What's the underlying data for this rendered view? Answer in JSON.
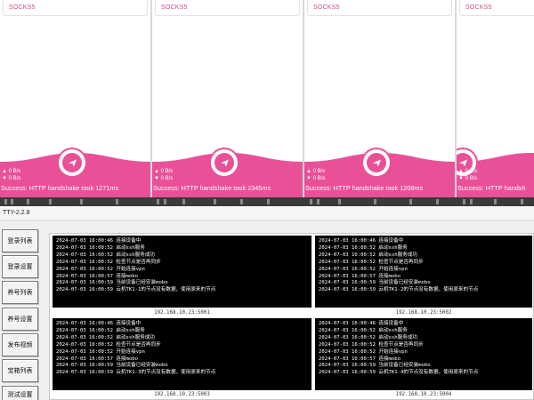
{
  "phones": [
    {
      "protocol": "SOCKS5",
      "up": "▲  0 B/s",
      "down": "▼  0 B/s",
      "status": "Success: HTTP handshake took 1271ms"
    },
    {
      "protocol": "SOCKS5",
      "up": "▲  0 B/s",
      "down": "▼  0 B/s",
      "status": "Success: HTTP handshake took 2345ms"
    },
    {
      "protocol": "SOCKS5",
      "up": "▲  0 B/s",
      "down": "▼  0 B/s",
      "status": "Success: HTTP handshake took 1208ms"
    },
    {
      "protocol": "SOCKS5",
      "up": "▲  0 B/s",
      "down": "▼  0 B/s",
      "status": "Success: HTTP handsh"
    }
  ],
  "app": {
    "title": "TTY-2.2.8"
  },
  "sidebar": {
    "items": [
      "登录列表",
      "登录设置",
      "养号列表",
      "养号设置",
      "发布视频",
      "宝箱列表",
      "测试设置"
    ]
  },
  "terminals": [
    {
      "label": "192.168.10.23:5001",
      "lines": [
        "2024-07-03 16:00:46 连接设备中",
        "2024-07-03 16:00:52 启动ssh服务",
        "2024-07-03 16:00:52 启动ssh服务成功",
        "2024-07-03 16:00:52 检查节点是否再同步",
        "2024-07-03 16:00:52 开始连接vpn",
        "2024-07-03 16:00:57 连接mobo",
        "2024-07-03 16:00:59 当前设备已经安装mobo",
        "2024-07-03 16:00:59 云机TK1-1的节点没有数据，使用原来的节点"
      ]
    },
    {
      "label": "192.168.10.23:5002",
      "lines": [
        "2024-07-03 16:00:46 连接设备中",
        "2024-07-03 16:00:52 启动ssh服务",
        "2024-07-03 16:00:52 启动ssh服务成功",
        "2024-07-03 16:00:52 检查节点是否再同步",
        "2024-07-03 16:00:52 开始连接vpn",
        "2024-07-03 16:00:57 连接mobo",
        "2024-07-03 16:00:59 当前设备已经安装mobo",
        "2024-07-03 16:00:59 云机TK1-2的节点没有数据，使用原来的节点"
      ]
    },
    {
      "label": "192.168.10.23:5003",
      "lines": [
        "2024-07-03 16:00:46 连接设备中",
        "2024-07-03 16:00:52 启动ssh服务",
        "2024-07-03 16:00:52 启动ssh服务成功",
        "2024-07-03 16:00:52 检查节点是否再同步",
        "2024-07-03 16:00:52 开始连接vpn",
        "2024-07-03 16:00:57 连接mobo",
        "2024-07-03 16:00:59 当前设备已经安装mobo",
        "2024-07-03 16:00:59 云机TK1-3的节点没有数据，使用原来的节点"
      ]
    },
    {
      "label": "192.168.10.23:5004",
      "lines": [
        "2024-07-03 16:00:46 连接设备中",
        "2024-07-03 16:00:52 启动ssh服务",
        "2024-07-03 16:00:52 启动ssh服务成功",
        "2024-07-03 16:00:52 检查节点是否再同步",
        "2024-07-03 16:00:52 开始连接vpn",
        "2024-07-03 16:00:57 连接mobo",
        "2024-07-03 16:00:59 当前设备已经安装mobo",
        "2024-07-03 16:00:59 云机TK1-4的节点没有数据，使用原来的节点"
      ]
    }
  ],
  "colors": {
    "accent": "#ea5098",
    "terminal_bg": "#000000",
    "terminal_fg": "#ffffff"
  },
  "icons": {
    "send": "paper-plane-icon"
  }
}
